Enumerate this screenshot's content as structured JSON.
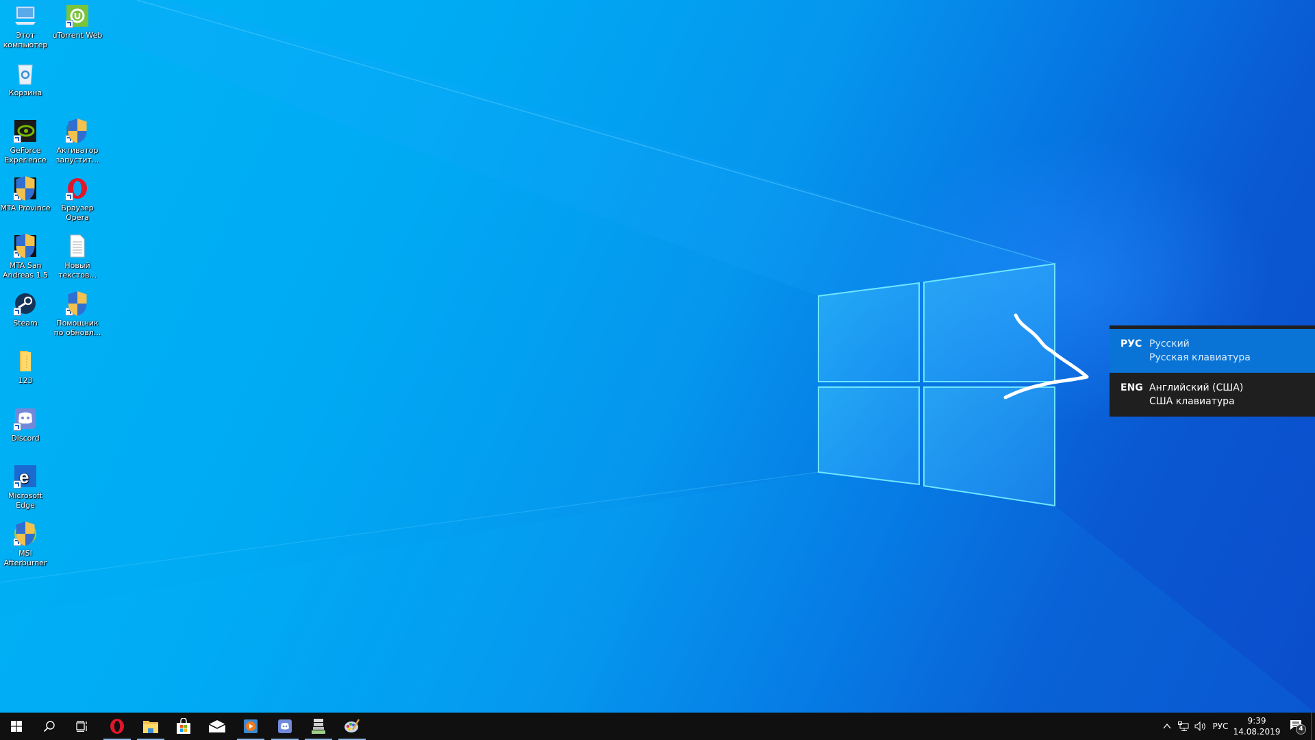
{
  "desktop": {
    "icons": [
      {
        "label": "Этот компьютер",
        "icon": "this-pc-icon",
        "shortcut": false
      },
      {
        "label": "uTorrent Web",
        "icon": "utorrent-icon",
        "shortcut": true
      },
      {
        "label": "Корзина",
        "icon": "recycle-bin-icon",
        "shortcut": false
      },
      {
        "label": "GeForce Experience",
        "icon": "geforce-icon",
        "shortcut": true
      },
      {
        "label": "Активатор запустит...",
        "icon": "activator-icon",
        "shortcut": true
      },
      {
        "label": "MTA Province",
        "icon": "mta-province-icon",
        "shortcut": true
      },
      {
        "label": "Браузер Opera",
        "icon": "opera-icon",
        "shortcut": true
      },
      {
        "label": "MTA San Andreas 1.5",
        "icon": "mta-san-andreas-icon",
        "shortcut": true
      },
      {
        "label": "Новый текстов...",
        "icon": "text-document-icon",
        "shortcut": false
      },
      {
        "label": "Steam",
        "icon": "steam-icon",
        "shortcut": true
      },
      {
        "label": "Помощник по обновл...",
        "icon": "update-assistant-icon",
        "shortcut": true
      },
      {
        "label": "123",
        "icon": "folder-icon",
        "shortcut": false
      },
      {
        "label": "Discord",
        "icon": "discord-icon",
        "shortcut": true
      },
      {
        "label": "Microsoft Edge",
        "icon": "edge-icon",
        "shortcut": true
      },
      {
        "label": "MSI Afterburner",
        "icon": "msi-afterburner-icon",
        "shortcut": true
      }
    ]
  },
  "language_popup": {
    "items": [
      {
        "code": "РУС",
        "language": "Русский",
        "layout": "Русская клавиатура",
        "selected": true
      },
      {
        "code": "ENG",
        "language": "Английский (США)",
        "layout": "США клавиатура",
        "selected": false
      }
    ]
  },
  "taskbar": {
    "buttons": [
      {
        "name": "start-button",
        "icon": "windows-icon",
        "running": false
      },
      {
        "name": "search-button",
        "icon": "search-icon",
        "running": false
      },
      {
        "name": "task-view-button",
        "icon": "task-view-icon",
        "running": false
      },
      {
        "name": "opera-taskbar-button",
        "icon": "opera-icon",
        "running": true
      },
      {
        "name": "file-explorer-taskbar-button",
        "icon": "file-explorer-icon",
        "running": true
      },
      {
        "name": "store-taskbar-button",
        "icon": "store-icon",
        "running": false
      },
      {
        "name": "mail-taskbar-button",
        "icon": "mail-icon",
        "running": false
      },
      {
        "name": "media-player-taskbar-button",
        "icon": "media-player-icon",
        "running": true
      },
      {
        "name": "discord-taskbar-button",
        "icon": "discord-icon",
        "running": true
      },
      {
        "name": "gta-province-taskbar-button",
        "icon": "gta-province-icon",
        "running": true
      },
      {
        "name": "paint-taskbar-button",
        "icon": "paint-icon",
        "running": true
      }
    ],
    "tray": {
      "input_indicator": "РУС",
      "time": "9:39",
      "date": "14.08.2019",
      "notification_count": "4"
    }
  },
  "colors": {
    "popup_selected": "#0a74d6",
    "popup_bg": "#1f1f1f",
    "taskbar_bg": "#101010"
  }
}
